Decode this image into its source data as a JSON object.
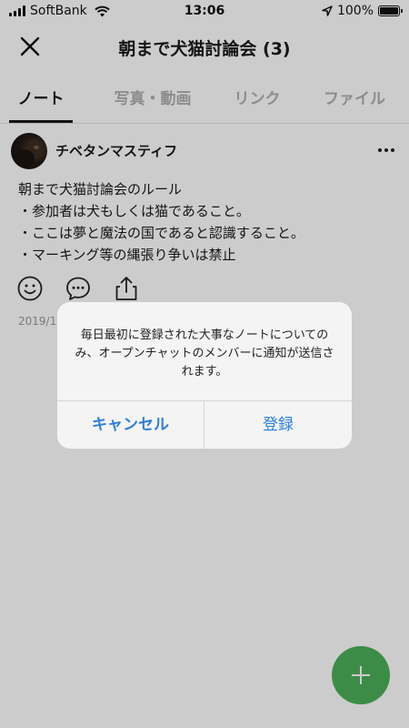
{
  "status_bar": {
    "carrier": "SoftBank",
    "time": "13:06",
    "battery": "100%"
  },
  "header": {
    "title": "朝まで犬猫討論会 (3)"
  },
  "tabs": [
    {
      "label": "ノート",
      "active": true
    },
    {
      "label": "写真・動画",
      "active": false
    },
    {
      "label": "リンク",
      "active": false
    },
    {
      "label": "ファイル",
      "active": false
    }
  ],
  "note": {
    "author": "チベタンマスティフ",
    "lines": [
      "朝まで犬猫討論会のルール",
      "・参加者は犬もしくは猫であること。",
      "・ここは夢と魔法の国であると認識すること。",
      "・マーキング等の縄張り争いは禁止"
    ],
    "date": "2019/1"
  },
  "dialog": {
    "message": "毎日最初に登録された大事なノートについてのみ、オープンチャットのメンバーに通知が送信されます。",
    "cancel_label": "キャンセル",
    "confirm_label": "登録"
  },
  "colors": {
    "accent": "#2f80d8",
    "fab": "#4cb05a"
  },
  "icons": [
    "close-icon",
    "more-icon",
    "smile-icon",
    "comment-icon",
    "share-icon",
    "plus-icon",
    "wifi-icon",
    "location-icon"
  ]
}
